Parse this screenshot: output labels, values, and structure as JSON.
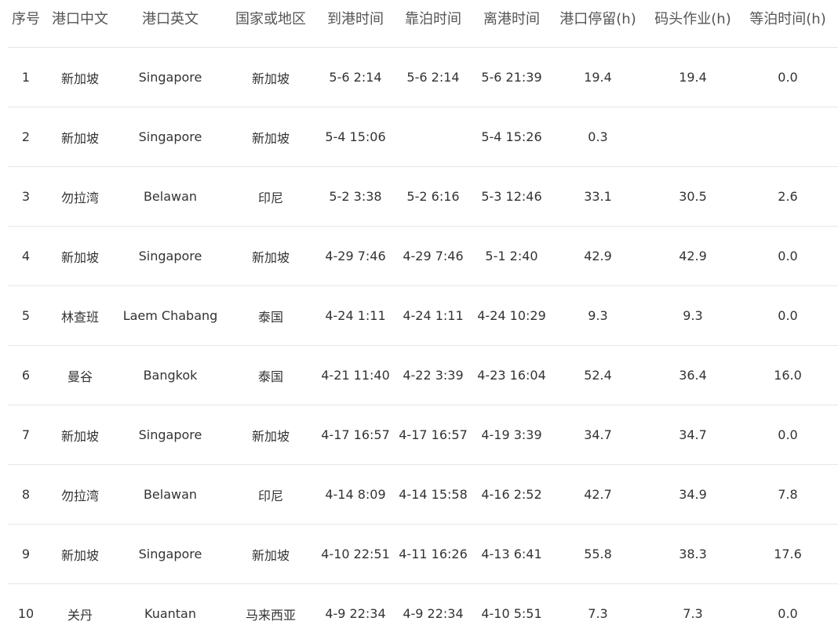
{
  "table": {
    "headers": [
      "序号",
      "港口中文",
      "港口英文",
      "国家或地区",
      "到港时间",
      "靠泊时间",
      "离港时间",
      "港口停留(h)",
      "码头作业(h)",
      "等泊时间(h)"
    ],
    "rows": [
      [
        "1",
        "新加坡",
        "Singapore",
        "新加坡",
        "5-6 2:14",
        "5-6 2:14",
        "5-6 21:39",
        "19.4",
        "19.4",
        "0.0"
      ],
      [
        "2",
        "新加坡",
        "Singapore",
        "新加坡",
        "5-4 15:06",
        "",
        "5-4 15:26",
        "0.3",
        "",
        ""
      ],
      [
        "3",
        "勿拉湾",
        "Belawan",
        "印尼",
        "5-2 3:38",
        "5-2 6:16",
        "5-3 12:46",
        "33.1",
        "30.5",
        "2.6"
      ],
      [
        "4",
        "新加坡",
        "Singapore",
        "新加坡",
        "4-29 7:46",
        "4-29 7:46",
        "5-1 2:40",
        "42.9",
        "42.9",
        "0.0"
      ],
      [
        "5",
        "林查班",
        "Laem Chabang",
        "泰国",
        "4-24 1:11",
        "4-24 1:11",
        "4-24 10:29",
        "9.3",
        "9.3",
        "0.0"
      ],
      [
        "6",
        "曼谷",
        "Bangkok",
        "泰国",
        "4-21 11:40",
        "4-22 3:39",
        "4-23 16:04",
        "52.4",
        "36.4",
        "16.0"
      ],
      [
        "7",
        "新加坡",
        "Singapore",
        "新加坡",
        "4-17 16:57",
        "4-17 16:57",
        "4-19 3:39",
        "34.7",
        "34.7",
        "0.0"
      ],
      [
        "8",
        "勿拉湾",
        "Belawan",
        "印尼",
        "4-14 8:09",
        "4-14 15:58",
        "4-16 2:52",
        "42.7",
        "34.9",
        "7.8"
      ],
      [
        "9",
        "新加坡",
        "Singapore",
        "新加坡",
        "4-10 22:51",
        "4-11 16:26",
        "4-13 6:41",
        "55.8",
        "38.3",
        "17.6"
      ],
      [
        "10",
        "关丹",
        "Kuantan",
        "马来西亚",
        "4-9 22:34",
        "4-9 22:34",
        "4-10 5:51",
        "7.3",
        "7.3",
        "0.0"
      ]
    ]
  }
}
